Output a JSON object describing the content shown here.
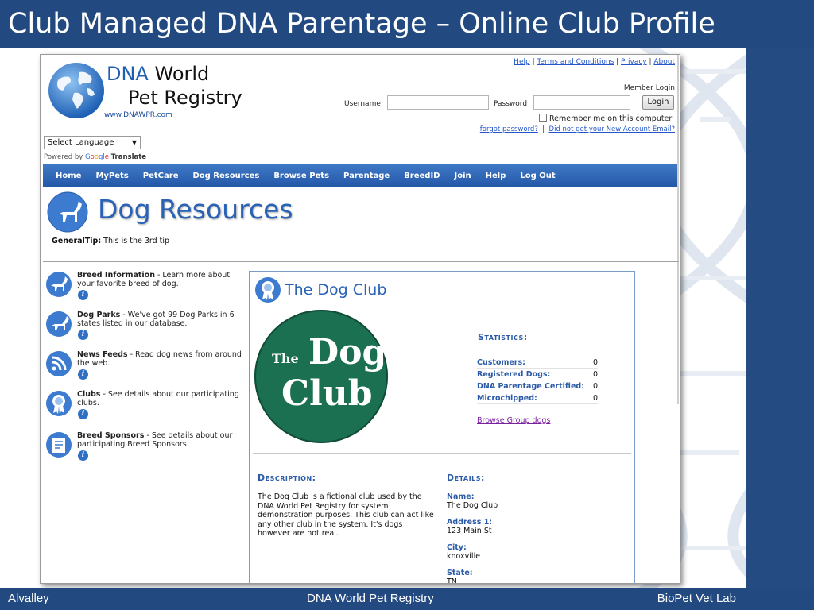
{
  "slide": {
    "title": "Club Managed DNA Parentage – Online Club Profile",
    "footer_left": "Alvalley",
    "footer_center": "DNA World Pet Registry",
    "footer_right": "BioPet Vet Lab"
  },
  "site": {
    "logo_line1_accent": "DNA",
    "logo_line1_rest": "World",
    "logo_line2": "Pet Registry",
    "logo_url": "www.DNAWPR.com"
  },
  "toplinks": [
    "Help",
    "Terms and Conditions",
    "Privacy",
    "About"
  ],
  "login": {
    "heading": "Member Login",
    "username_label": "Username",
    "username_value": "",
    "password_label": "Password",
    "password_value": "",
    "button": "Login",
    "remember": "Remember me on this computer",
    "forgot": "forgot password?",
    "separator": "|",
    "no_email": "Did not get your New Account Email?"
  },
  "language": {
    "select": "Select Language",
    "powered_by": "Powered by",
    "google": [
      "G",
      "o",
      "o",
      "g",
      "l",
      "e"
    ],
    "translate": "Translate"
  },
  "nav": [
    "Home",
    "MyPets",
    "PetCare",
    "Dog Resources",
    "Browse Pets",
    "Parentage",
    "BreedID",
    "Join",
    "Help",
    "Log Out"
  ],
  "page": {
    "title": "Dog Resources",
    "tip_label": "GeneralTip:",
    "tip_text": "This is the 3rd tip"
  },
  "resources": [
    {
      "name": "Breed Information",
      "desc": " - Learn more about your favorite breed of dog.",
      "icon": "dog-icon"
    },
    {
      "name": "Dog Parks",
      "desc": " - We've got 99 Dog Parks in 6 states listed in our database.",
      "icon": "dog-park-icon"
    },
    {
      "name": "News Feeds",
      "desc": " - Read dog news from around the web.",
      "icon": "rss-feed-icon"
    },
    {
      "name": "Clubs",
      "desc": " - See details about our participating clubs.",
      "icon": "ribbon-icon"
    },
    {
      "name": "Breed Sponsors",
      "desc": " - See details about our participating Breed Sponsors",
      "icon": "sponsor-certificate-icon"
    }
  ],
  "club": {
    "title": "The Dog Club",
    "logo_text": [
      "The",
      "Dog",
      "Club"
    ],
    "stats_heading": "Statistics:",
    "stats": [
      {
        "label": "Customers:",
        "value": "0"
      },
      {
        "label": "Registered Dogs:",
        "value": "0"
      },
      {
        "label": "DNA Parentage Certified:",
        "value": "0"
      },
      {
        "label": "Microchipped:",
        "value": "0"
      }
    ],
    "browse_link": "Browse Group dogs",
    "description_heading": "Description:",
    "description": "The Dog Club is a fictional club used by the DNA World Pet Registry for system demonstration purposes. This club can act like any other club in the system. It's dogs however are not real.",
    "details_heading": "Details:",
    "details": [
      {
        "label": "Name:",
        "value": "The Dog Club"
      },
      {
        "label": "Address 1:",
        "value": "123 Main St"
      },
      {
        "label": "City:",
        "value": "knoxville"
      },
      {
        "label": "State:",
        "value": "TN"
      }
    ]
  },
  "colors": {
    "slide_blue": "#234a80",
    "nav_blue": "#2458a8",
    "heading_blue": "#2a63b5",
    "club_green": "#1a7050"
  }
}
